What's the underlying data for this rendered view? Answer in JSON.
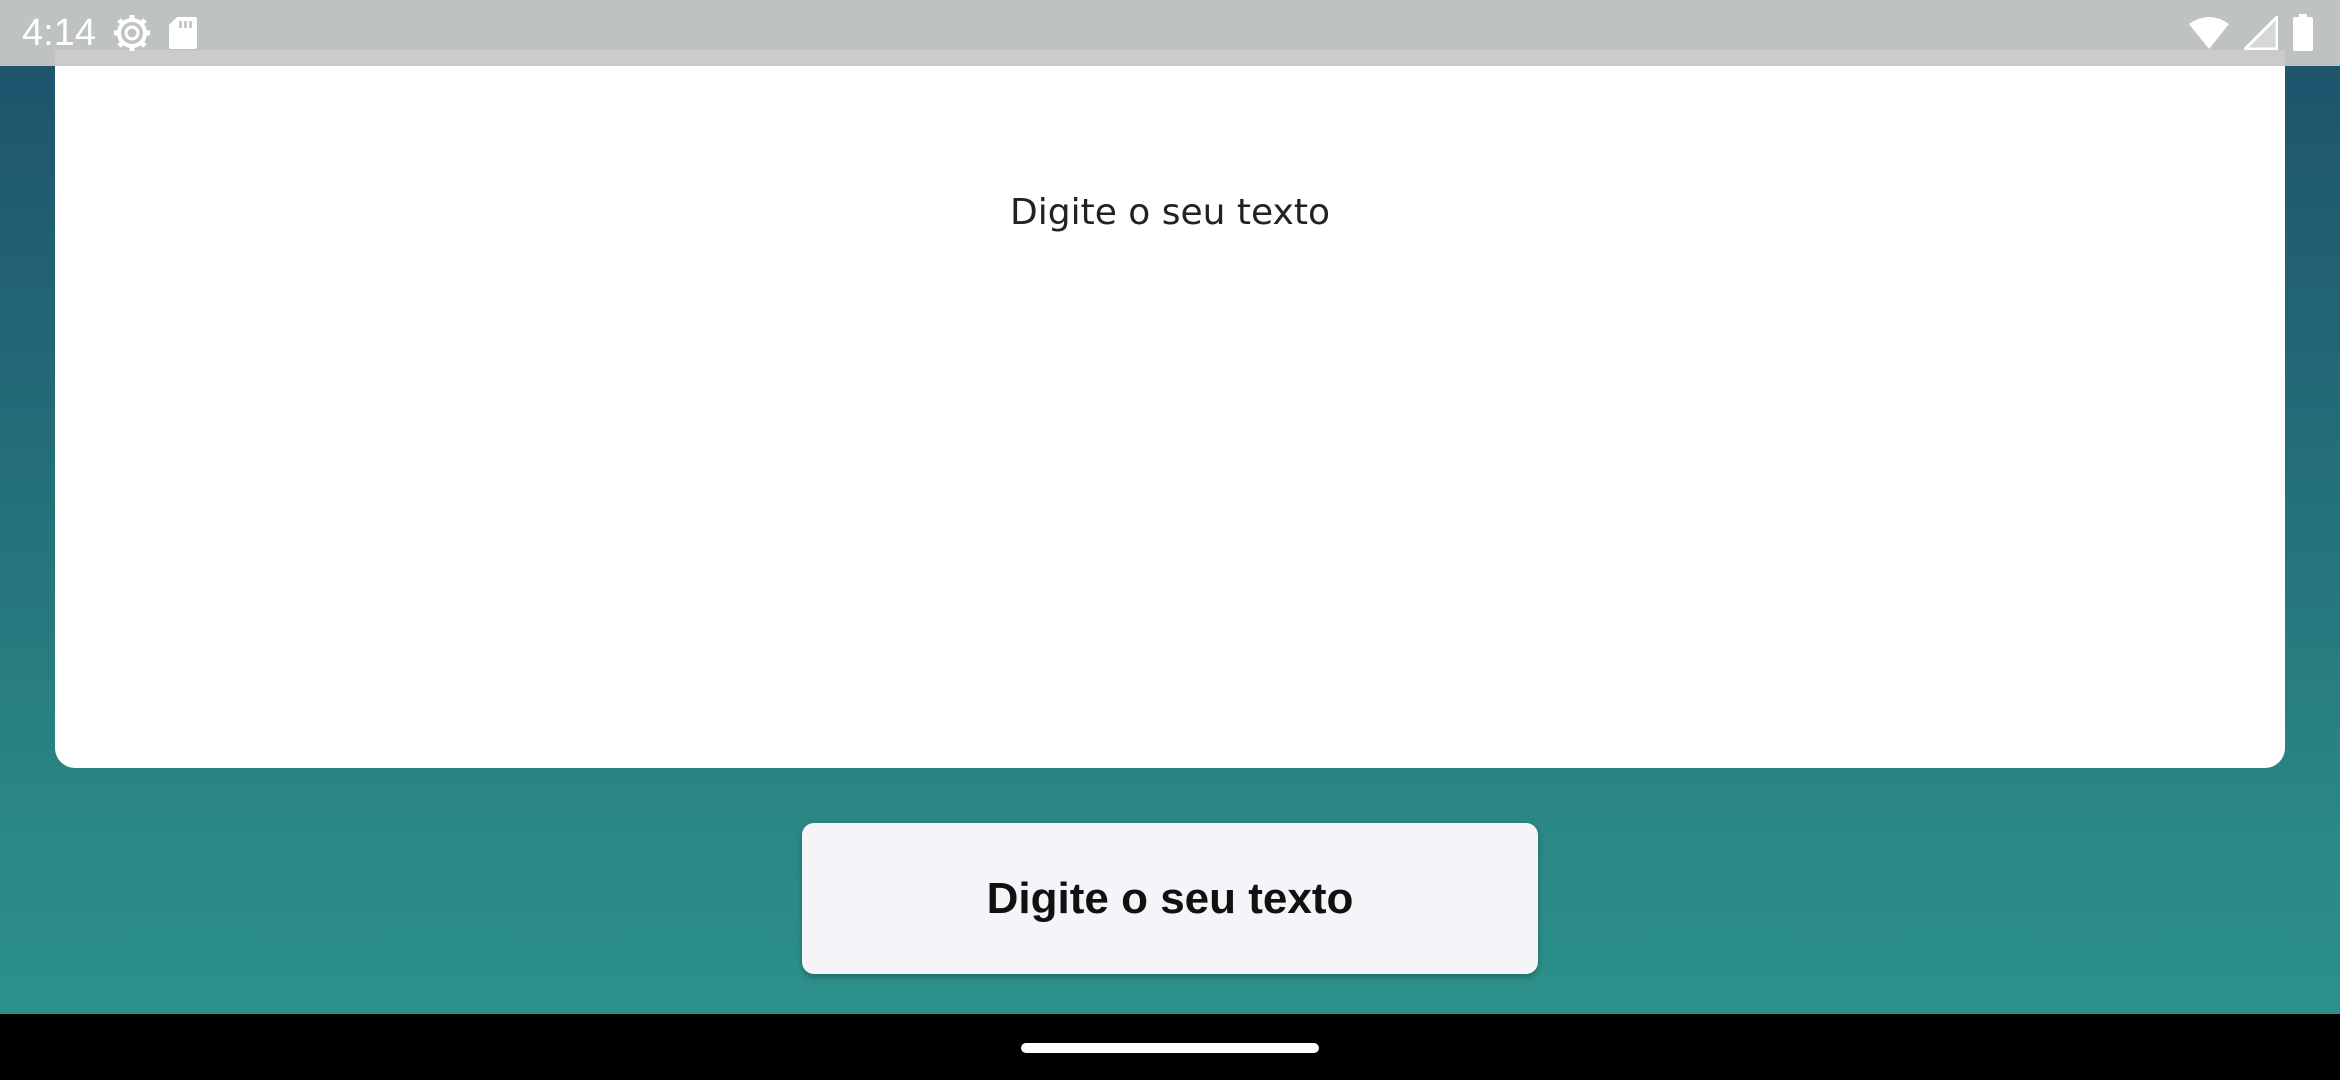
{
  "status_bar": {
    "time": "4:14",
    "left_icons": [
      "settings-icon",
      "sd-card-icon"
    ],
    "right_icons": [
      "wifi-icon",
      "cell-signal-icon",
      "battery-icon"
    ]
  },
  "card": {
    "text": "Digite o seu texto"
  },
  "button": {
    "label": "Digite o seu texto"
  },
  "colors": {
    "background_top": "#1e4f6b",
    "background_bottom": "#2c938c",
    "card": "#ffffff",
    "button": "#f4f4f9",
    "nav_bar": "#000000"
  }
}
